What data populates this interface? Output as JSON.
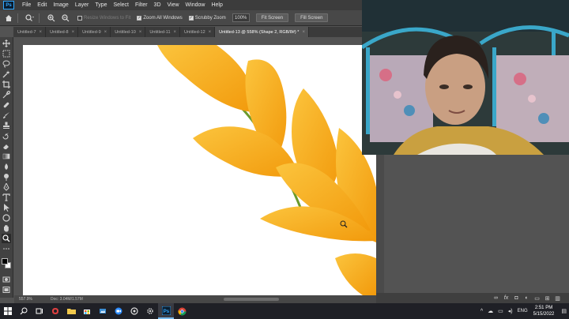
{
  "menu": {
    "logo": "Ps",
    "items": [
      "File",
      "Edit",
      "Image",
      "Layer",
      "Type",
      "Select",
      "Filter",
      "3D",
      "View",
      "Window",
      "Help"
    ]
  },
  "options": {
    "resize_windows": "Resize Windows to Fit",
    "zoom_all_windows": "Zoom All Windows",
    "scrubby_zoom": "Scrubby Zoom",
    "zoom_percent": "100%",
    "fit_screen": "Fit Screen",
    "fill_screen": "Fill Screen"
  },
  "tabs": [
    {
      "label": "Untitled-7"
    },
    {
      "label": "Untitled-8"
    },
    {
      "label": "Untitled-9"
    },
    {
      "label": "Untitled-10"
    },
    {
      "label": "Untitled-11"
    },
    {
      "label": "Untitled-12"
    },
    {
      "label": "Untitled-13 @ 558% (Shape 2, RGB/8#) *"
    }
  ],
  "status": {
    "zoom": "557.9%",
    "doc": "Doc: 3.04M/1.57M"
  },
  "taskbar": {
    "language": "ENG",
    "time": "2:51 PM",
    "date": "5/15/2022"
  },
  "colors": {
    "accent": "#31a8ff",
    "petal": "#f8b62a",
    "petal_dark": "#f29a0c",
    "stem": "#6b9a2b"
  }
}
